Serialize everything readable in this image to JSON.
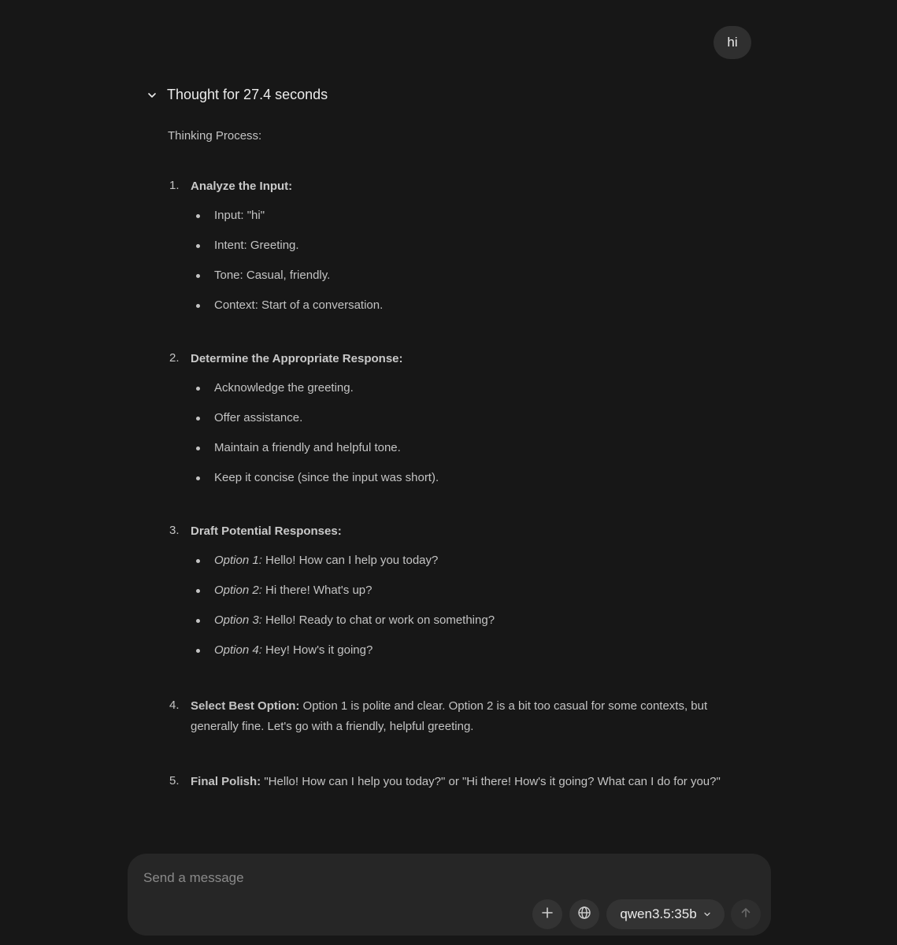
{
  "user_message": "hi",
  "thought": {
    "title": "Thought for 27.4 seconds",
    "process_label": "Thinking Process:",
    "steps": [
      {
        "number": "1.",
        "heading": "Analyze the Input:",
        "bullets": [
          "Input: \"hi\"",
          "Intent: Greeting.",
          "Tone: Casual, friendly.",
          "Context: Start of a conversation."
        ]
      },
      {
        "number": "2.",
        "heading": "Determine the Appropriate Response:",
        "bullets": [
          "Acknowledge the greeting.",
          "Offer assistance.",
          "Maintain a friendly and helpful tone.",
          "Keep it concise (since the input was short)."
        ]
      },
      {
        "number": "3.",
        "heading": "Draft Potential Responses:",
        "options": [
          {
            "label": "Option 1:",
            "text": "Hello! How can I help you today?"
          },
          {
            "label": "Option 2:",
            "text": "Hi there! What's up?"
          },
          {
            "label": "Option 3:",
            "text": "Hello! Ready to chat or work on something?"
          },
          {
            "label": "Option 4:",
            "text": "Hey! How's it going?"
          }
        ]
      },
      {
        "number": "4.",
        "heading": "Select Best Option:",
        "text": "Option 1 is polite and clear. Option 2 is a bit too casual for some contexts, but generally fine. Let's go with a friendly, helpful greeting."
      },
      {
        "number": "5.",
        "heading": "Final Polish:",
        "text": "\"Hello! How can I help you today?\" or \"Hi there! How's it going? What can I do for you?\""
      }
    ]
  },
  "composer": {
    "placeholder": "Send a message",
    "model": "qwen3.5:35b"
  },
  "icons": {
    "collapse": "chevron-down-icon",
    "add": "plus-icon",
    "web": "globe-icon",
    "model_dropdown": "chevron-down-icon",
    "send": "arrow-up-icon"
  }
}
